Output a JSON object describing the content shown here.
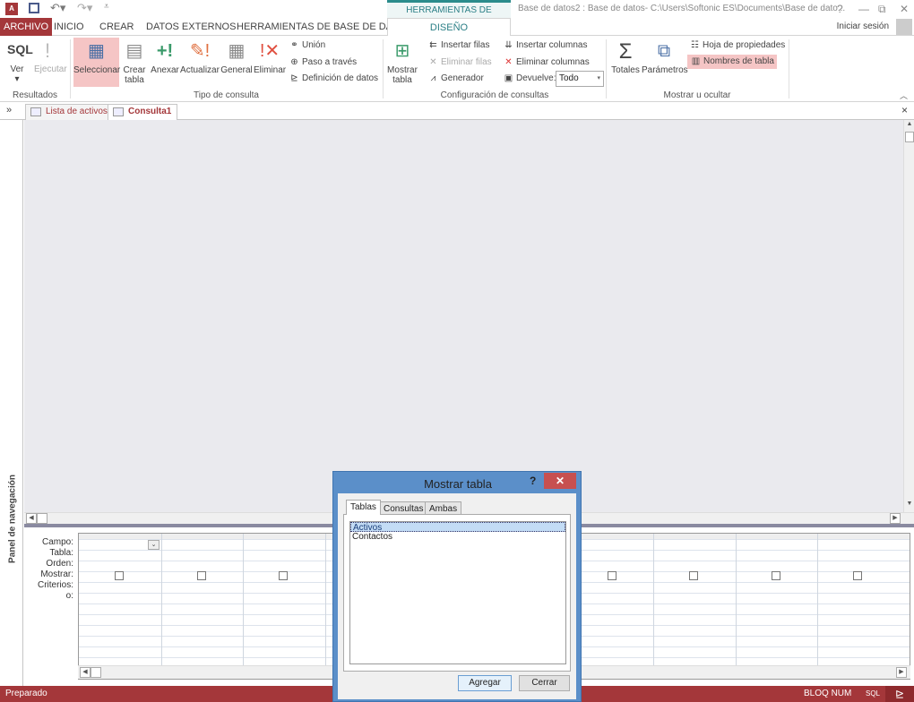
{
  "app": {
    "contextual_tab": "HERRAMIENTAS DE CONSULTAS",
    "window_title": "Base de datos2 : Base de datos- C:\\Users\\Softonic ES\\Documents\\Base de dato...",
    "help": "?",
    "minimize": "—",
    "restore": "⧉",
    "close": "✕",
    "signin": "Iniciar sesión"
  },
  "tabs": [
    "ARCHIVO",
    "INICIO",
    "CREAR",
    "DATOS EXTERNOS",
    "HERRAMIENTAS DE BASE DE DATOS",
    "DISEÑO"
  ],
  "ribbon": {
    "resultados": {
      "label": "Resultados",
      "ver": "Ver",
      "ejecutar": "Ejecutar",
      "sql": "SQL"
    },
    "tipo": {
      "label": "Tipo de consulta",
      "seleccionar": "Seleccionar",
      "crear_tabla": "Crear tabla",
      "anexar": "Anexar",
      "actualizar": "Actualizar",
      "general": "General",
      "eliminar": "Eliminar",
      "union": "Unión",
      "paso": "Paso a través",
      "definicion": "Definición de datos"
    },
    "config": {
      "label": "Configuración de consultas",
      "mostrar_tabla": "Mostrar tabla",
      "insertar_filas": "Insertar filas",
      "eliminar_filas": "Eliminar filas",
      "generador": "Generador",
      "insertar_columnas": "Insertar columnas",
      "eliminar_columnas": "Eliminar columnas",
      "devuelve": "Devuelve:",
      "devuelve_value": "Todo"
    },
    "mostrar": {
      "label": "Mostrar u ocultar",
      "totales": "Totales",
      "parametros": "Parámetros",
      "hoja": "Hoja de propiedades",
      "nombres": "Nombres de tabla"
    }
  },
  "doc_tabs": {
    "expand": "»",
    "items": [
      "Lista de activos",
      "Consulta1"
    ],
    "active": "Consulta1",
    "close": "×"
  },
  "nav_pane": "Panel de navegación",
  "grid": {
    "row_labels": [
      "Campo:",
      "Tabla:",
      "Orden:",
      "Mostrar:",
      "Criterios:",
      "o:"
    ],
    "columns": 10
  },
  "dialog": {
    "title": "Mostrar tabla",
    "help": "?",
    "close": "✕",
    "tabs": [
      "Tablas",
      "Consultas",
      "Ambas"
    ],
    "active_tab": "Tablas",
    "items": [
      "Activos",
      "Contactos"
    ],
    "selected": "Activos",
    "add": "Agregar",
    "close_btn": "Cerrar"
  },
  "status": {
    "left": "Preparado",
    "numlock": "BLOQ NUM",
    "sql": "SQL"
  },
  "colors": {
    "accent": "#a4373a",
    "contextual": "#2b8c8c",
    "dialog": "#5b8fc9",
    "highlight": "#f5c5c5"
  }
}
